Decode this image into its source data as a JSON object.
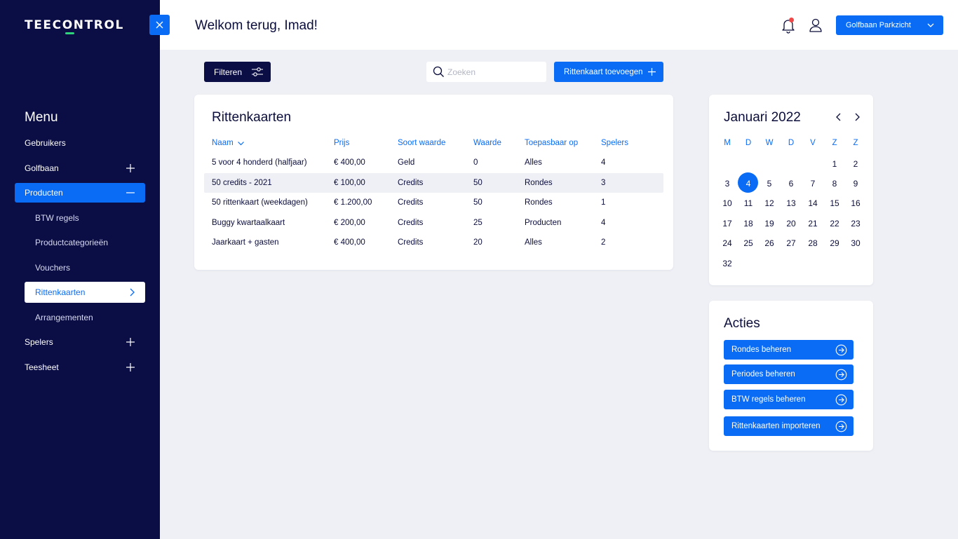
{
  "brand": {
    "logo": "TEECONTROL",
    "accent": "#0a6cf5",
    "dark": "#0b0d45",
    "green": "#2ed47a"
  },
  "sidebar": {
    "menu_title": "Menu",
    "items": [
      {
        "label": "Gebruikers"
      },
      {
        "label": "Golfbaan"
      },
      {
        "label": "Producten"
      },
      {
        "label": "Spelers"
      },
      {
        "label": "Teesheet"
      }
    ],
    "sub_items": [
      {
        "label": "BTW regels"
      },
      {
        "label": "Productcategorieën"
      },
      {
        "label": "Vouchers"
      },
      {
        "label": "Rittenkaarten"
      },
      {
        "label": "Arrangementen"
      }
    ]
  },
  "header": {
    "welcome": "Welkom terug, Imad!",
    "course": "Golfbaan Parkzicht"
  },
  "toolbar": {
    "filter_label": "Filteren",
    "search_placeholder": "Zoeken",
    "add_label": "Rittenkaart toevoegen"
  },
  "table": {
    "title": "Rittenkaarten",
    "headers": [
      "Naam",
      "Prijs",
      "Soort waarde",
      "Waarde",
      "Toepasbaar op",
      "Spelers"
    ],
    "rows": [
      [
        "5 voor 4 honderd (halfjaar)",
        "€ 400,00",
        "Geld",
        "0",
        "Alles",
        "4"
      ],
      [
        "50 credits - 2021",
        "€ 100,00",
        "Credits",
        "50",
        "Rondes",
        "3"
      ],
      [
        "50 rittenkaart (weekdagen)",
        "€ 1.200,00",
        "Credits",
        "50",
        "Rondes",
        "1"
      ],
      [
        "Buggy kwartaalkaart",
        "€ 200,00",
        "Credits",
        "25",
        "Producten",
        "4"
      ],
      [
        "Jaarkaart + gasten",
        "€ 400,00",
        "Credits",
        "20",
        "Alles",
        "2"
      ]
    ]
  },
  "calendar": {
    "title": "Januari 2022",
    "day_headers": [
      "M",
      "D",
      "W",
      "D",
      "V",
      "Z",
      "Z"
    ],
    "weeks": [
      [
        "",
        "",
        "",
        "",
        "",
        "1",
        "2"
      ],
      [
        "3",
        "4",
        "5",
        "6",
        "7",
        "8",
        "9"
      ],
      [
        "10",
        "11",
        "12",
        "13",
        "14",
        "15",
        "16"
      ],
      [
        "17",
        "18",
        "19",
        "20",
        "21",
        "22",
        "23"
      ],
      [
        "24",
        "25",
        "26",
        "27",
        "28",
        "29",
        "30"
      ],
      [
        "32",
        "",
        "",
        "",
        "",
        "",
        ""
      ]
    ],
    "selected_day": "4"
  },
  "actions": {
    "title": "Acties",
    "buttons": [
      {
        "label": "Rondes beheren"
      },
      {
        "label": "Periodes beheren"
      },
      {
        "label": "BTW regels beheren"
      },
      {
        "label": "Rittenkaarten importeren"
      }
    ]
  }
}
